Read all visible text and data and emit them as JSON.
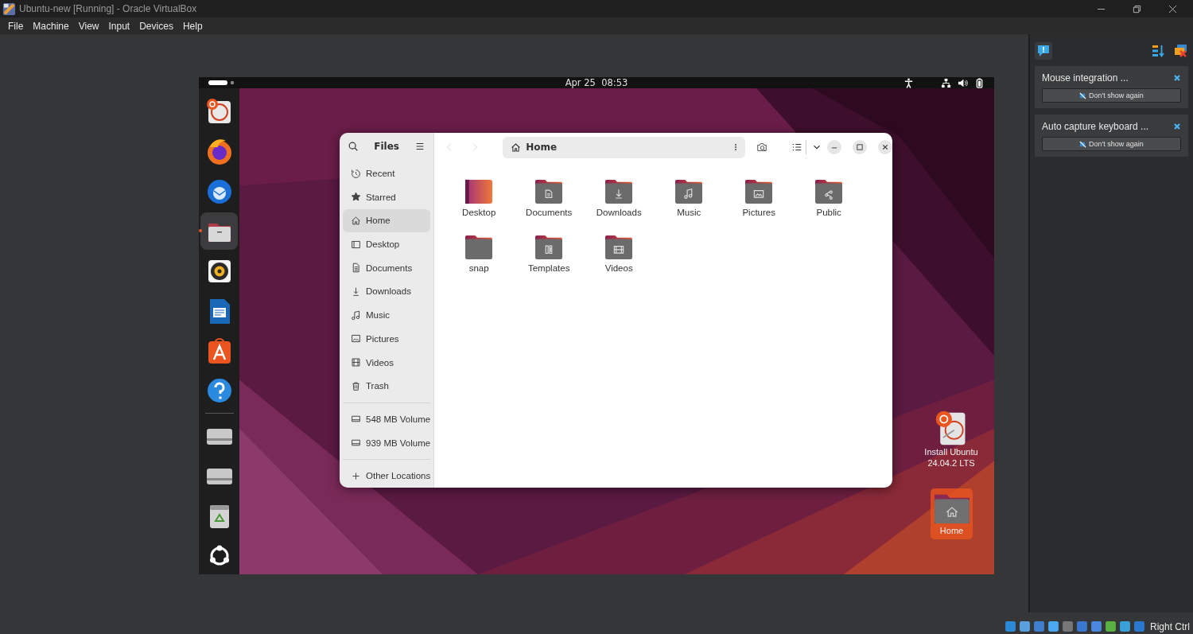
{
  "window": {
    "title": "Ubuntu-new [Running] - Oracle VirtualBox"
  },
  "menu": [
    "File",
    "Machine",
    "View",
    "Input",
    "Devices",
    "Help"
  ],
  "vm": {
    "top_bar": {
      "clock": "Apr 25  08:53"
    },
    "dock": [
      {
        "kind": "updater",
        "selected": false
      },
      {
        "kind": "browser",
        "selected": false
      },
      {
        "kind": "mail",
        "selected": false
      },
      {
        "kind": "files",
        "selected": true
      },
      {
        "kind": "speaker",
        "selected": false
      },
      {
        "kind": "writer",
        "selected": false
      },
      {
        "kind": "store",
        "selected": false
      },
      {
        "kind": "help",
        "selected": false
      },
      {
        "kind": "drive",
        "selected": false
      },
      {
        "kind": "drive",
        "selected": false
      },
      {
        "kind": "trash",
        "selected": false
      },
      {
        "kind": "apps",
        "selected": false
      }
    ],
    "desktop_icons": [
      {
        "kind": "installer",
        "label": "Install Ubuntu 24.04.2 LTS",
        "selected": false
      },
      {
        "kind": "home",
        "label": "Home",
        "selected": true
      }
    ],
    "files_window": {
      "title": "Files",
      "path": "Home",
      "sidebar": [
        {
          "kind": "recent",
          "label": "Recent",
          "selected": false
        },
        {
          "kind": "starred",
          "label": "Starred",
          "selected": false
        },
        {
          "kind": "home",
          "label": "Home",
          "selected": true
        },
        {
          "kind": "desktop",
          "label": "Desktop",
          "selected": false
        },
        {
          "kind": "documents",
          "label": "Documents",
          "selected": false
        },
        {
          "kind": "downloads",
          "label": "Downloads",
          "selected": false
        },
        {
          "kind": "music",
          "label": "Music",
          "selected": false
        },
        {
          "kind": "pictures",
          "label": "Pictures",
          "selected": false
        },
        {
          "kind": "videos",
          "label": "Videos",
          "selected": false
        },
        {
          "kind": "trash",
          "label": "Trash",
          "selected": false
        }
      ],
      "volumes": [
        {
          "kind": "drive",
          "label": "548 MB Volume",
          "selected": false
        },
        {
          "kind": "drive",
          "label": "939 MB Volume",
          "selected": false
        }
      ],
      "other": [
        {
          "kind": "other",
          "label": "Other Locations",
          "selected": false
        }
      ],
      "items": [
        {
          "kind": "desktop",
          "label": "Desktop"
        },
        {
          "kind": "documents",
          "label": "Documents"
        },
        {
          "kind": "downloads",
          "label": "Downloads"
        },
        {
          "kind": "music",
          "label": "Music"
        },
        {
          "kind": "pictures",
          "label": "Pictures"
        },
        {
          "kind": "public",
          "label": "Public"
        },
        {
          "kind": "snap",
          "label": "snap"
        },
        {
          "kind": "templates",
          "label": "Templates"
        },
        {
          "kind": "videos",
          "label": "Videos"
        }
      ]
    }
  },
  "notifications": [
    {
      "title": "Mouse integration ...",
      "button": "Don't show again"
    },
    {
      "title": "Auto capture keyboard ...",
      "button": "Don't show again"
    }
  ],
  "status_bar": {
    "host_key": "Right Ctrl"
  }
}
